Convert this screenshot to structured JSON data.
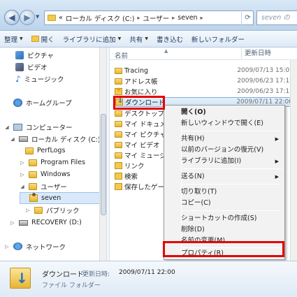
{
  "addressbar": {
    "path_prefix": "«",
    "crumbs": [
      "ローカル ディスク (C:)",
      "ユーザー",
      "seven"
    ],
    "search_placeholder": "seven の"
  },
  "commandbar": {
    "items": [
      "整理",
      "開く",
      "ライブラリに追加",
      "共有",
      "書き込む",
      "新しいフォルダー"
    ]
  },
  "navpane": {
    "libraries": [
      "ピクチャ",
      "ビデオ",
      "ミュージック"
    ],
    "homegroup": "ホームグループ",
    "computer": "コンピューター",
    "local_disk": "ローカル ディスク (C:)",
    "folders": [
      "PerfLogs",
      "Program Files",
      "Windows",
      "ユーザー",
      "seven",
      "パブリック"
    ],
    "recovery": "RECOVERY (D:)",
    "network": "ネットワーク"
  },
  "filelist": {
    "header_name": "名前",
    "header_date": "更新日時",
    "rows": [
      {
        "name": "Tracing",
        "date": "2009/07/13 15:01"
      },
      {
        "name": "アドレス帳",
        "date": "2009/06/23 17:19"
      },
      {
        "name": "お気に入り",
        "date": "2009/06/23 17:19"
      },
      {
        "name": "ダウンロード",
        "date": "2009/07/11 22:00"
      },
      {
        "name": "デスクトップ",
        "date": ""
      },
      {
        "name": "マイ ドキュメント",
        "date": ""
      },
      {
        "name": "マイ ピクチャ",
        "date": ""
      },
      {
        "name": "マイ ビデオ",
        "date": ""
      },
      {
        "name": "マイ ミュージック",
        "date": ""
      },
      {
        "name": "リンク",
        "date": ""
      },
      {
        "name": "検索",
        "date": ""
      },
      {
        "name": "保存したゲーム",
        "date": ""
      }
    ]
  },
  "context_menu": {
    "open": "開く(O)",
    "open_new_window": "新しいウィンドウで開く(E)",
    "share": "共有(H)",
    "restore_previous": "以前のバージョンの復元(V)",
    "add_to_library": "ライブラリに追加(I)",
    "send_to": "送る(N)",
    "cut": "切り取り(T)",
    "copy": "コピー(C)",
    "create_shortcut": "ショートカットの作成(S)",
    "delete": "削除(D)",
    "rename": "名前の変更(M)",
    "properties": "プロパティ(R)"
  },
  "details": {
    "name": "ダウンロード",
    "meta_label": "更新日時:",
    "meta_value": "2009/07/11 22:00",
    "type": "ファイル フォルダー"
  },
  "colors": {
    "highlight_red": "#e40000",
    "selection_blue": "#cfe4f7"
  }
}
